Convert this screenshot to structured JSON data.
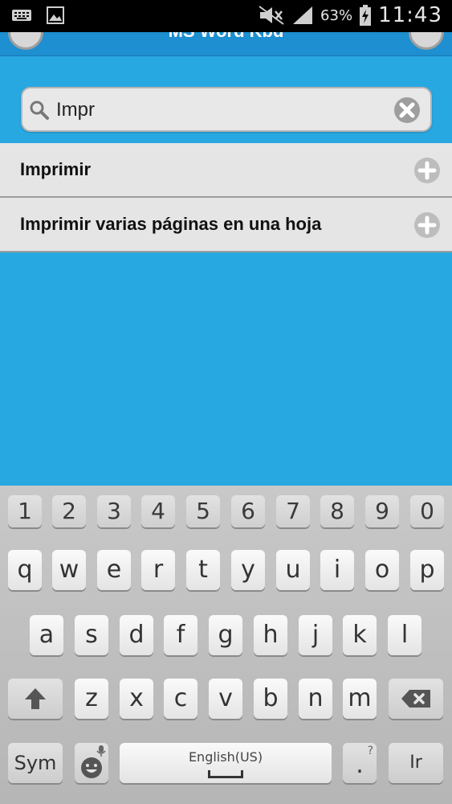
{
  "status_bar": {
    "battery_percent": "63%",
    "time": "11:43"
  },
  "header": {
    "title": "MS Word Kbd"
  },
  "search": {
    "value": "Impr",
    "placeholder": ""
  },
  "results": [
    {
      "label": "Imprimir"
    },
    {
      "label": "Imprimir varias páginas en una hoja"
    }
  ],
  "keyboard": {
    "numbers": [
      "1",
      "2",
      "3",
      "4",
      "5",
      "6",
      "7",
      "8",
      "9",
      "0"
    ],
    "row1": [
      "q",
      "w",
      "e",
      "r",
      "t",
      "y",
      "u",
      "i",
      "o",
      "p"
    ],
    "row2": [
      "a",
      "s",
      "d",
      "f",
      "g",
      "h",
      "j",
      "k",
      "l"
    ],
    "row3": [
      "z",
      "x",
      "c",
      "v",
      "b",
      "n",
      "m"
    ],
    "sym_label": "Sym",
    "space_label": "English(US)",
    "period_label": ".",
    "period_hint": "?",
    "enter_label": "Ir"
  },
  "colors": {
    "background": "#28a8e1",
    "header": "#1e8fd0",
    "list_item": "#e5e5e5"
  }
}
